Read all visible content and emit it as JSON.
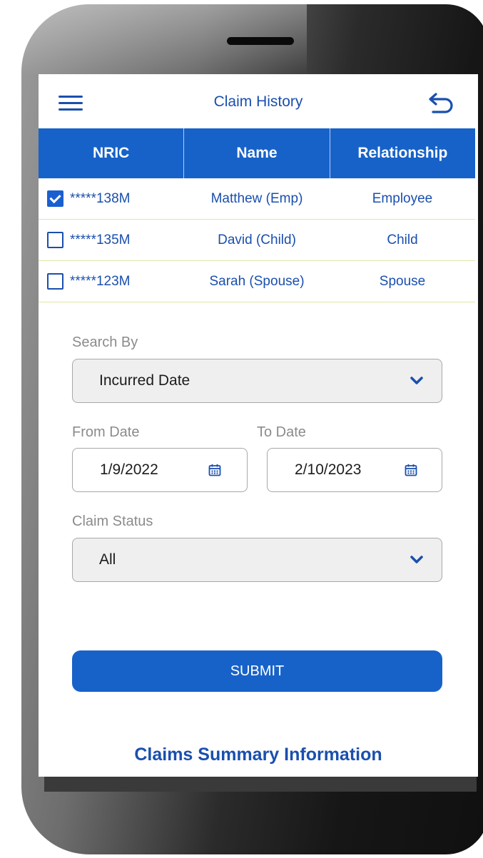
{
  "header": {
    "title": "Claim History",
    "menu_icon": "hamburger-menu-icon",
    "back_icon": "undo-arrow-icon"
  },
  "table": {
    "headers": [
      "NRIC",
      "Name",
      "Relationship"
    ],
    "rows": [
      {
        "checked": true,
        "nric": "*****138M",
        "name": "Matthew (Emp)",
        "relationship": "Employee"
      },
      {
        "checked": false,
        "nric": "*****135M",
        "name": "David (Child)",
        "relationship": "Child"
      },
      {
        "checked": false,
        "nric": "*****123M",
        "name": "Sarah (Spouse)",
        "relationship": "Spouse"
      }
    ]
  },
  "form": {
    "search_by_label": "Search By",
    "search_by_value": "Incurred Date",
    "from_date_label": "From Date",
    "from_date_value": "1/9/2022",
    "to_date_label": "To Date",
    "to_date_value": "2/10/2023",
    "claim_status_label": "Claim Status",
    "claim_status_value": "All",
    "submit_label": "SUBMIT"
  },
  "footer": {
    "summary_link": "Claims Summary Information"
  },
  "colors": {
    "primary": "#1762c8",
    "text_blue": "#1a4fae",
    "label_gray": "#8b8b8b"
  }
}
